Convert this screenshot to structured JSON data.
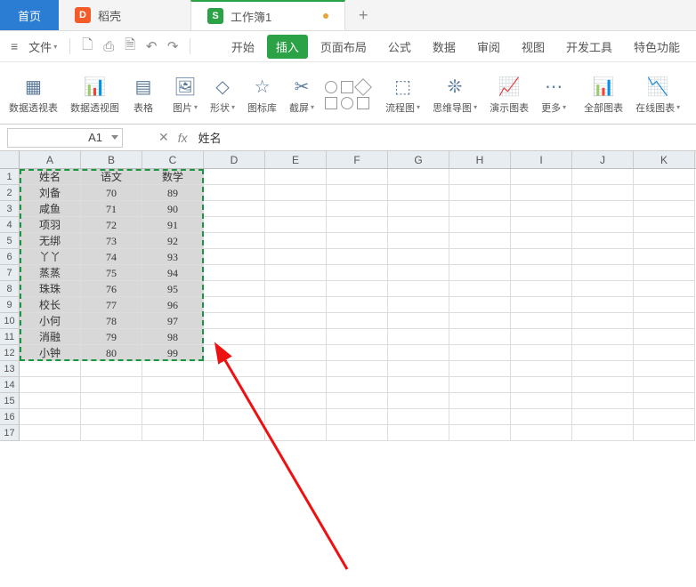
{
  "tabs": {
    "home": "首页",
    "dao": "稻壳",
    "workbook": "工作簿1"
  },
  "menu": {
    "file": "文件",
    "items": [
      "开始",
      "插入",
      "页面布局",
      "公式",
      "数据",
      "审阅",
      "视图",
      "开发工具",
      "特色功能"
    ],
    "active_index": 1
  },
  "ribbon": {
    "pivot_table": "数据透视表",
    "pivot_chart": "数据透视图",
    "table": "表格",
    "picture": "图片",
    "shapes": "形状",
    "icon_lib": "图标库",
    "screenshot": "截屏",
    "flowchart": "流程图",
    "mindmap": "思维导图",
    "demo_chart": "演示图表",
    "more": "更多",
    "all_charts": "全部图表",
    "online_chart": "在线图表"
  },
  "formula_bar": {
    "name_box": "A1",
    "value": "姓名"
  },
  "columns": [
    "A",
    "B",
    "C",
    "D",
    "E",
    "F",
    "G",
    "H",
    "I",
    "J",
    "K"
  ],
  "sheet_data": {
    "headers": [
      "姓名",
      "语文",
      "数学"
    ],
    "rows": [
      [
        "刘备",
        "70",
        "89"
      ],
      [
        "咸鱼",
        "71",
        "90"
      ],
      [
        "项羽",
        "72",
        "91"
      ],
      [
        "无绑",
        "73",
        "92"
      ],
      [
        "丫丫",
        "74",
        "93"
      ],
      [
        "蒸蒸",
        "75",
        "94"
      ],
      [
        "珠珠",
        "76",
        "95"
      ],
      [
        "校长",
        "77",
        "96"
      ],
      [
        "小何",
        "78",
        "97"
      ],
      [
        "消融",
        "79",
        "98"
      ],
      [
        "小钟",
        "80",
        "99"
      ]
    ]
  }
}
